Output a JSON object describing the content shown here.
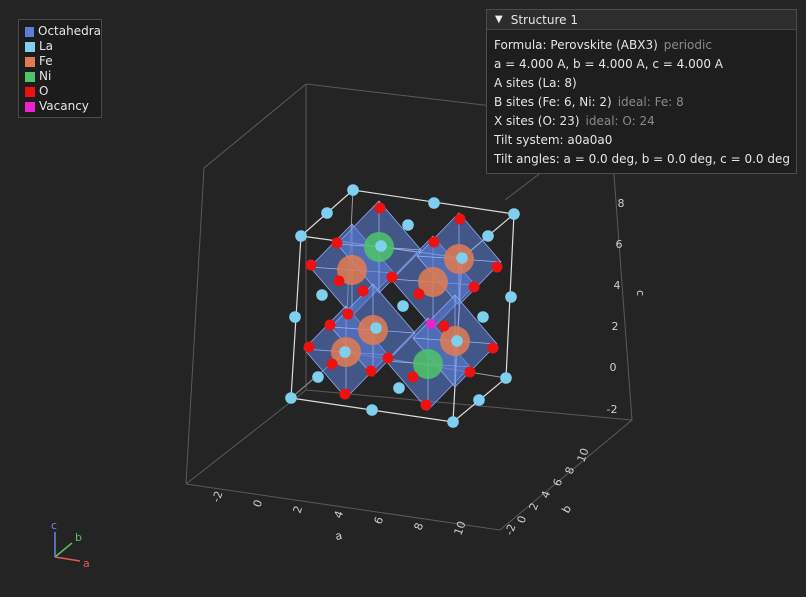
{
  "legend": {
    "items": [
      {
        "label": "Octahedra",
        "color": "#5b7fd9"
      },
      {
        "label": "La",
        "color": "#7fd0f0"
      },
      {
        "label": "Fe",
        "color": "#e07b52"
      },
      {
        "label": "Ni",
        "color": "#4ec46a"
      },
      {
        "label": "O",
        "color": "#ee1111"
      },
      {
        "label": "Vacancy",
        "color": "#ee22cc"
      }
    ]
  },
  "panel": {
    "title": "Structure 1",
    "formula_label": "Formula: Perovskite (ABX3)",
    "formula_note": "periodic",
    "lattice": "a = 4.000 A, b = 4.000 A, c = 4.000 A",
    "a_sites": "A sites (La: 8)",
    "b_sites": "B sites (Fe: 6, Ni: 2)",
    "b_ideal": "ideal: Fe: 8",
    "x_sites": "X sites (O: 23)",
    "x_ideal": "ideal: O: 24",
    "tilt_system": "Tilt system: a0a0a0",
    "tilt_angles": "Tilt angles: a = 0.0 deg, b = 0.0 deg, c = 0.0 deg"
  },
  "axes": {
    "a_label": "a",
    "b_label": "b",
    "c_label": "c",
    "a_ticks": [
      "-2",
      "0",
      "2",
      "4",
      "6",
      "8",
      "10"
    ],
    "b_ticks": [
      "-2",
      "0",
      "2",
      "4",
      "6",
      "8",
      "10"
    ],
    "c_ticks": [
      "-2",
      "0",
      "2",
      "4",
      "6",
      "8"
    ]
  },
  "gizmo": {
    "a": "a",
    "b": "b",
    "c": "c"
  }
}
